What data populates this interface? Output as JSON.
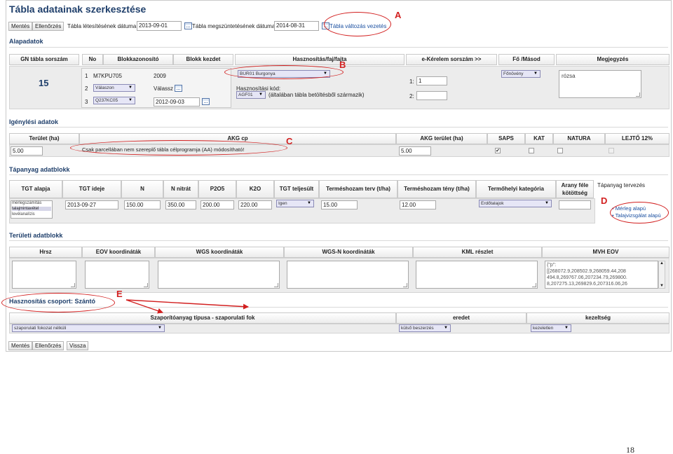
{
  "title": "Tábla adatainak szerkesztése",
  "toolbar": {
    "save": "Mentés",
    "check": "Ellenőrzés",
    "created_label": "Tábla létesítésének dátuma",
    "created_value": "2013-09-01",
    "ended_label": "Tábla megszüntetésének dátuma",
    "ended_value": "2014-08-31",
    "change_link": "Tábla változás vezetés"
  },
  "basic": {
    "heading": "Alapadatok",
    "headers": {
      "gn": "GN tábla sorszám",
      "no": "No",
      "block_id": "Blokkazonosító",
      "block_start": "Blokk kezdet",
      "usage": "Hasznosítás/faj/fajta",
      "e_request": "e-Kérelem sorszám >>",
      "main_sec": "Fő /Másod",
      "note": "Megjegyzés"
    },
    "gn_value": "15",
    "rows": [
      {
        "no": "1",
        "block": "M7KPU705",
        "start": "2009"
      },
      {
        "no": "2",
        "block": "Válaszon",
        "start": "Válassz"
      },
      {
        "no": "3",
        "block": "Q237KC05",
        "start": "2012-09-03"
      }
    ],
    "usage_select": "BUR01 Burgonya",
    "usage_code_label": "Hasznosítási kód:",
    "usage_code_select": "AGF01",
    "usage_code_note": "(általában tábla betöltésből származik)",
    "e_request_1_label": "1:",
    "e_request_1_value": "1",
    "e_request_2_label": "2:",
    "main_sec_select": "Főnövény",
    "note_value": "rózsa"
  },
  "claim": {
    "heading": "Igénylési adatok",
    "headers": {
      "area": "Terület (ha)",
      "akg": "AKG cp",
      "akg_area": "AKG terület (ha)",
      "saps": "SAPS",
      "kat": "KAT",
      "natura": "NATURA",
      "lejto": "LEJTŐ 12%"
    },
    "area_value": "5.00",
    "akg_note": "Csak parcellában nem szereplő tábla célprogramja (AA) módosítható!",
    "akg_area_value": "5.00",
    "saps_checked": "✔"
  },
  "nutrient": {
    "heading": "Tápanyag adatblokk",
    "headers": {
      "tgt_basis": "TGT alapja",
      "tgt_time": "TGT ideje",
      "n": "N",
      "n_nitrate": "N nitrát",
      "p2o5": "P2O5",
      "k2o": "K2O",
      "tgt_done": "TGT teljesült",
      "yield_plan": "Terméshozam terv (t/ha)",
      "yield_actual": "Terméshozam tény (t/ha)",
      "site_category": "Termőhelyi kategória",
      "ratio_line1": "Arany féle",
      "ratio_line2": "kötöttség",
      "plan": "Tápanyag tervezés"
    },
    "basis_options": [
      "mérlegszámítás",
      "talajmintavétel",
      "levélanalízis"
    ],
    "tgt_time_value": "2013-09-27",
    "n_value": "150.00",
    "n_nitrate_value": "350.00",
    "p2o5_value": "200.00",
    "k2o_value": "220.00",
    "tgt_done_select": "Igen",
    "yield_plan_value": "15.00",
    "yield_actual_value": "12.00",
    "site_category_select": "Erdőtalajok",
    "plan_links": [
      "Mérleg alapú",
      "Talajvizsgálat alapú"
    ]
  },
  "area": {
    "heading": "Területi adatblokk",
    "headers": {
      "hrsz": "Hrsz",
      "eov": "EOV koordináták",
      "wgs": "WGS koordináták",
      "wgsn": "WGS-N koordináták",
      "kml": "KML részlet",
      "mvh": "MVH EOV"
    },
    "mvh_lines": [
      "{\"p\":",
      "[[268072.9,208502.9,268059.44,208",
      "494.8,269767.06,207234.79,269800.",
      "8,207275.13,269829.6,207316.06,26"
    ]
  },
  "group": {
    "heading": "Hasznosítás csoport: Szántó",
    "headers": {
      "type": "Szaporítóanyag típusa - szaporulati fok",
      "origin": "eredet",
      "treatment": "kezeltség"
    },
    "type_select": "szaporulati fokozat nélküli",
    "origin_select": "külső beszerzés",
    "treatment_select": "kezeletlen"
  },
  "bottom_buttons": {
    "save": "Mentés",
    "check": "Ellenőrzés",
    "back": "Vissza"
  },
  "annotations": {
    "a": "A",
    "b": "B",
    "c": "C",
    "d": "D",
    "e": "E",
    "color": "#d21f1f"
  },
  "page_number": "18"
}
